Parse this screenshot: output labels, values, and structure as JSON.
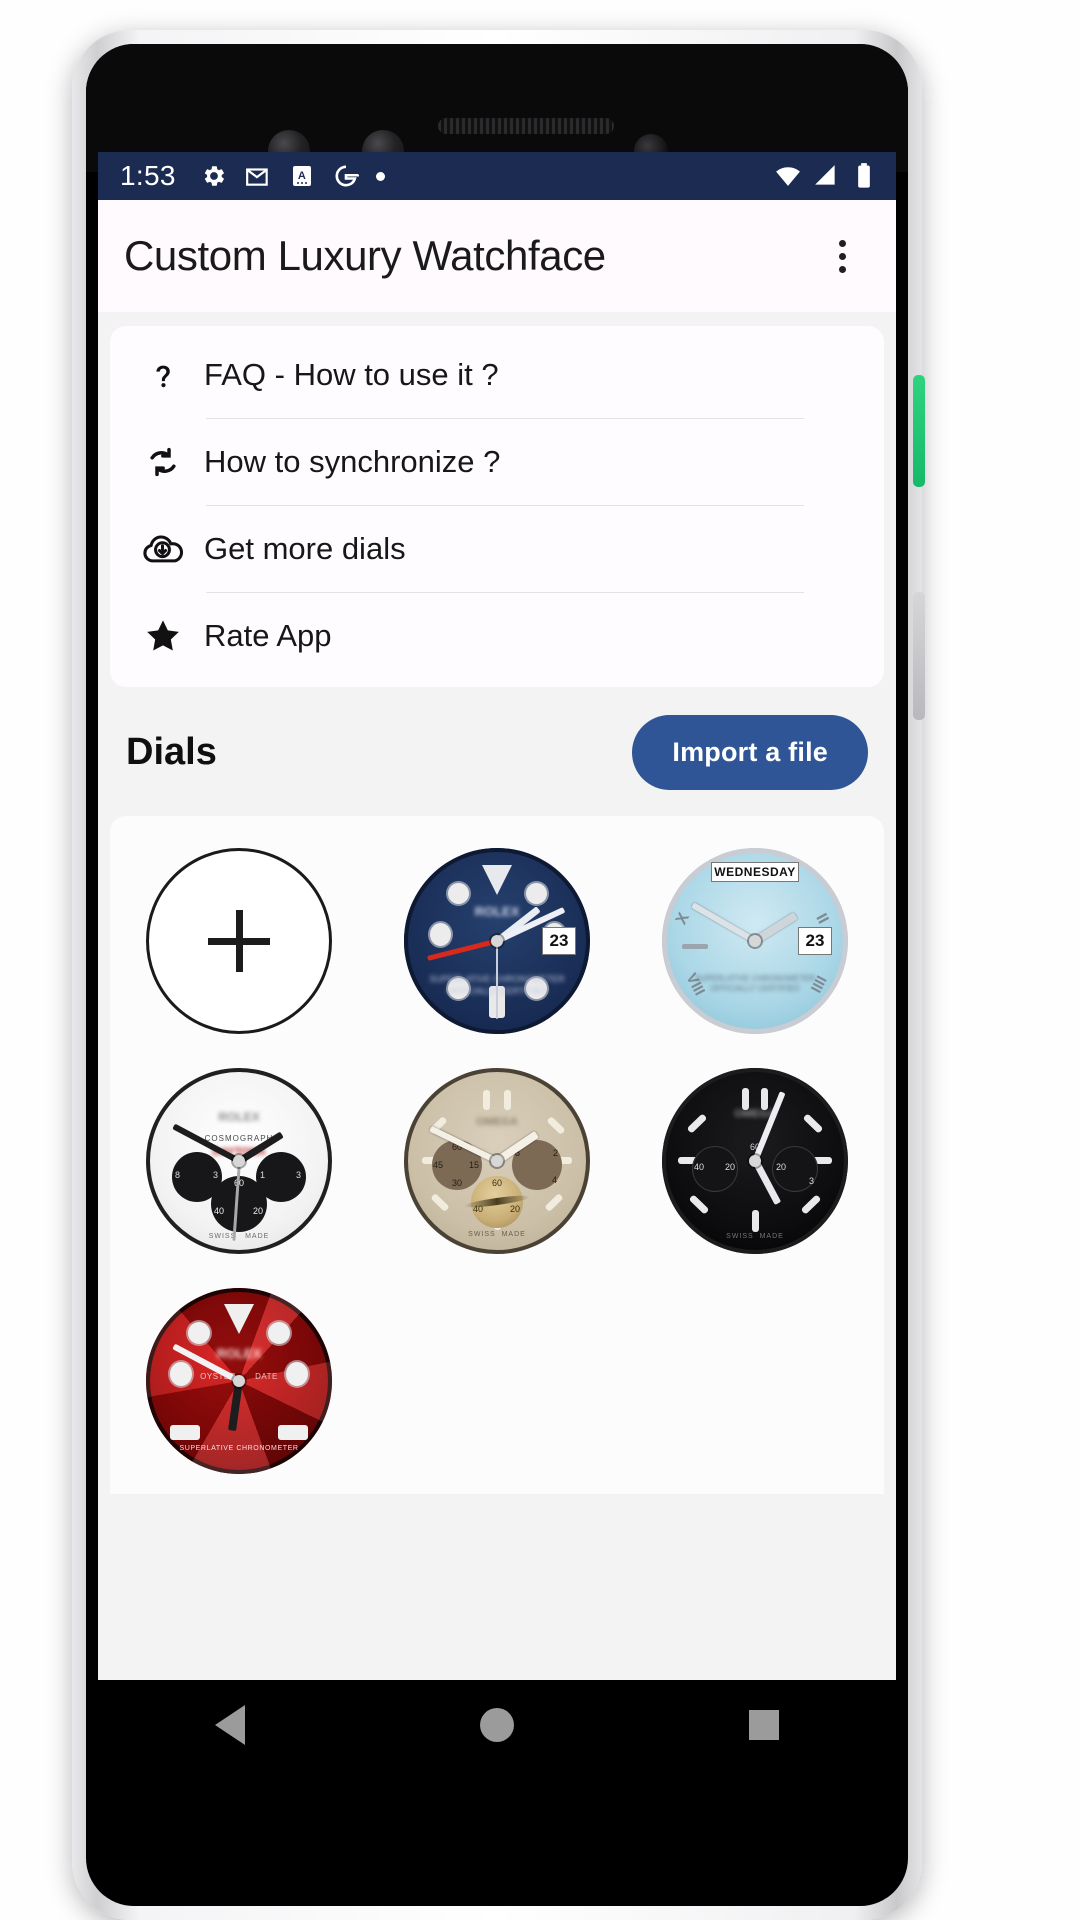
{
  "status_bar": {
    "time": "1:53",
    "left_icons": [
      "gear-icon",
      "gmail-icon",
      "a-box-icon",
      "google-g-icon",
      "dot-icon"
    ],
    "right_icons": [
      "wifi-icon",
      "cellular-signal-icon",
      "battery-icon"
    ],
    "background_color": "#1c2b51"
  },
  "app_bar": {
    "title": "Custom Luxury Watchface",
    "overflow_icon": "more-vert-icon",
    "background_color": "#fffafd"
  },
  "menu": {
    "items": [
      {
        "label": "FAQ - How to use it ?",
        "icon": "question-mark-icon"
      },
      {
        "label": "How to synchronize ?",
        "icon": "sync-icon"
      },
      {
        "label": "Get more dials",
        "icon": "cloud-download-icon"
      },
      {
        "label": "Rate App",
        "icon": "star-icon"
      }
    ]
  },
  "dials_section": {
    "title": "Dials",
    "import_button": "Import a file",
    "import_button_color": "#2f5596",
    "items": [
      {
        "name": "add-new-dial",
        "type": "add",
        "label": "+"
      },
      {
        "name": "submariner-navy-dial",
        "type": "watch",
        "style": "navy-diver",
        "date": "23",
        "text_lines": [
          "SUPERLATIVE CHRONOMETER",
          "OFFICIALLY CERTIFIED"
        ]
      },
      {
        "name": "day-date-ice-blue-dial",
        "type": "watch",
        "style": "iceblue-daydate",
        "date": "23",
        "day": "WEDNESDAY",
        "text_lines": [
          "SUPERLATIVE CHRONOMETER",
          "OFFICIALLY CERTIFIED"
        ]
      },
      {
        "name": "daytona-white-dial",
        "type": "watch",
        "style": "white-chrono",
        "text_lines": [
          "COSMOGRAPH",
          "DAYTONA",
          "SWISS MADE"
        ],
        "subdial_numbers": [
          "8",
          "3",
          "60",
          "40",
          "20",
          "1"
        ]
      },
      {
        "name": "speedmaster-beige-dial",
        "type": "watch",
        "style": "beige-chrono",
        "text_lines": [
          "SWISS MADE"
        ],
        "subdial_numbers": [
          "60",
          "45",
          "30",
          "15",
          "8",
          "2",
          "4",
          "40",
          "20"
        ]
      },
      {
        "name": "speedmaster-black-dial",
        "type": "watch",
        "style": "black-chrono",
        "text_lines": [
          "SWISS MADE"
        ],
        "subdial_numbers": [
          "60",
          "40",
          "20",
          "3"
        ]
      },
      {
        "name": "submariner-red-dial",
        "type": "watch",
        "style": "red-diver",
        "text_lines": [
          "OYSTER PERPETUAL DATE",
          "SUPERLATIVE CHRONOMETER"
        ]
      }
    ]
  },
  "nav_bar": {
    "items": [
      {
        "label": "back",
        "icon": "triangle-back-icon"
      },
      {
        "label": "home",
        "icon": "circle-home-icon"
      },
      {
        "label": "recents",
        "icon": "square-recents-icon"
      }
    ]
  }
}
